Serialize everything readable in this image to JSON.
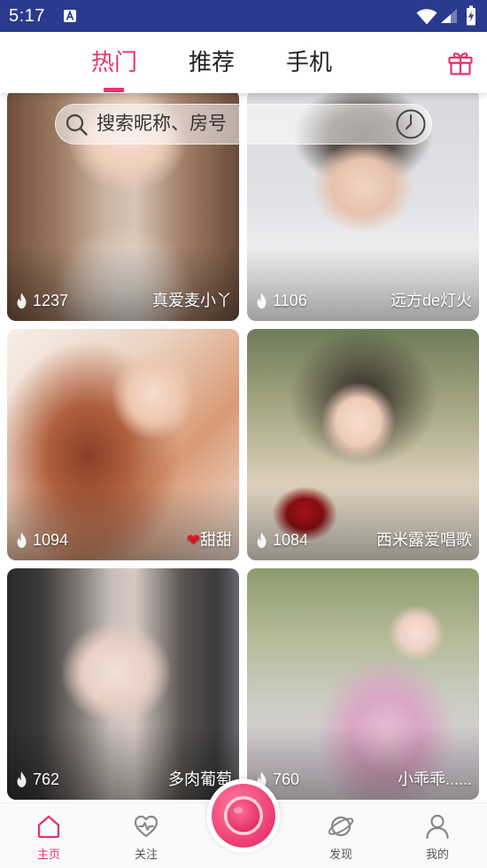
{
  "theme": {
    "accent": "#e8336b",
    "status_bar": "#2b3a8e"
  },
  "status_bar": {
    "time": "5:17",
    "icons": [
      "notification-a-icon",
      "wifi-icon",
      "signal-icon",
      "battery-charging-icon"
    ]
  },
  "header": {
    "tabs": [
      {
        "label": "热门",
        "active": true
      },
      {
        "label": "推荐",
        "active": false
      },
      {
        "label": "手机",
        "active": false
      }
    ],
    "right_icon": "gift-icon"
  },
  "search": {
    "placeholder": "搜索昵称、房号",
    "left_icon": "search-icon",
    "right_icon": "history-clock-icon"
  },
  "rooms": [
    {
      "heat": "1237",
      "name": "真爱麦小丫"
    },
    {
      "heat": "1106",
      "name": "远方de灯火"
    },
    {
      "heat": "1094",
      "name": "❤甜甜"
    },
    {
      "heat": "1084",
      "name": "西米露爱唱歌"
    },
    {
      "heat": "762",
      "name": "多肉葡萄"
    },
    {
      "heat": "760",
      "name": "小乖乖......"
    }
  ],
  "bottom_nav": {
    "items": [
      {
        "label": "主页",
        "icon": "home-icon",
        "active": true
      },
      {
        "label": "关注",
        "icon": "heart-pulse-icon",
        "active": false
      },
      {
        "label": "发现",
        "icon": "planet-icon",
        "active": false
      },
      {
        "label": "我的",
        "icon": "person-icon",
        "active": false
      }
    ],
    "center_icon": "live-camera-icon"
  }
}
